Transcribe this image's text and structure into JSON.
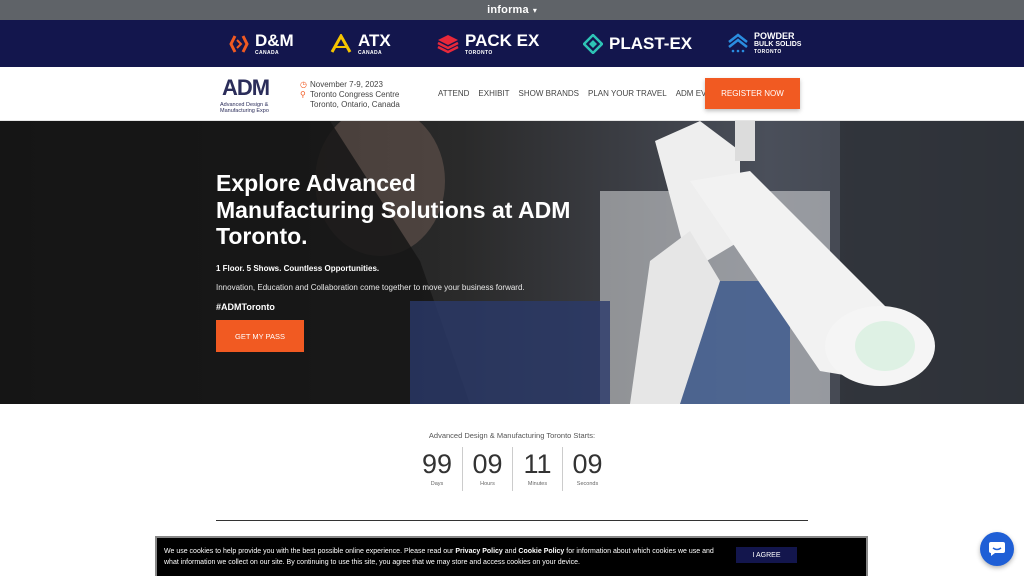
{
  "informa": {
    "brand": "informa",
    "caret": "▾"
  },
  "brands": [
    {
      "name": "D&M",
      "sub": "CANADA",
      "color": "#f15a22"
    },
    {
      "name": "ATX",
      "sub": "CANADA",
      "color": "#f5c400"
    },
    {
      "name": "PACK EX",
      "sub": "TORONTO",
      "color": "#e8283a"
    },
    {
      "name": "PLAST-EX",
      "sub": "",
      "color": "#2ec4b6"
    },
    {
      "name": "POWDER BULK SOLIDS",
      "line1": "POWDER",
      "line2": "BULK SOLIDS",
      "sub": "TORONTO",
      "color": "#2a8de0"
    }
  ],
  "header": {
    "logo_main": "ADM",
    "logo_sub": "Advanced Design & Manufacturing Expo",
    "date": "November 7-9, 2023",
    "venue_line1": "Toronto Congress Centre",
    "venue_line2": "Toronto, Ontario, Canada",
    "nav": [
      "ATTEND",
      "EXHIBIT",
      "SHOW BRANDS",
      "PLAN YOUR TRAVEL",
      "ADM EVENTS"
    ],
    "register_label": "REGISTER NOW"
  },
  "hero": {
    "title": "Explore Advanced Manufacturing Solutions at ADM Toronto.",
    "subtitle": "1 Floor. 5 Shows. Countless Opportunities.",
    "description": "Innovation, Education and Collaboration come together to move your business forward.",
    "hashtag": "#ADMToronto",
    "cta_label": "GET MY PASS"
  },
  "countdown": {
    "label": "Advanced Design & Manufacturing Toronto Starts:",
    "units": [
      {
        "value": "99",
        "label": "Days"
      },
      {
        "value": "09",
        "label": "Hours"
      },
      {
        "value": "11",
        "label": "Minutes"
      },
      {
        "value": "09",
        "label": "Seconds"
      }
    ]
  },
  "cookie": {
    "text_before": "We use cookies to help provide you with the best possible online experience. Please read our",
    "privacy_link": "Privacy Policy",
    "text_and": "and",
    "cookie_link": "Cookie Policy",
    "text_after": "for information about which cookies we use and what information we collect on our site. By continuing to use this site, you agree that we may store and access cookies on your device.",
    "agree_label": "I AGREE"
  },
  "colors": {
    "accent": "#f15a22",
    "navy": "#13164d",
    "chat": "#1f5fd6"
  }
}
